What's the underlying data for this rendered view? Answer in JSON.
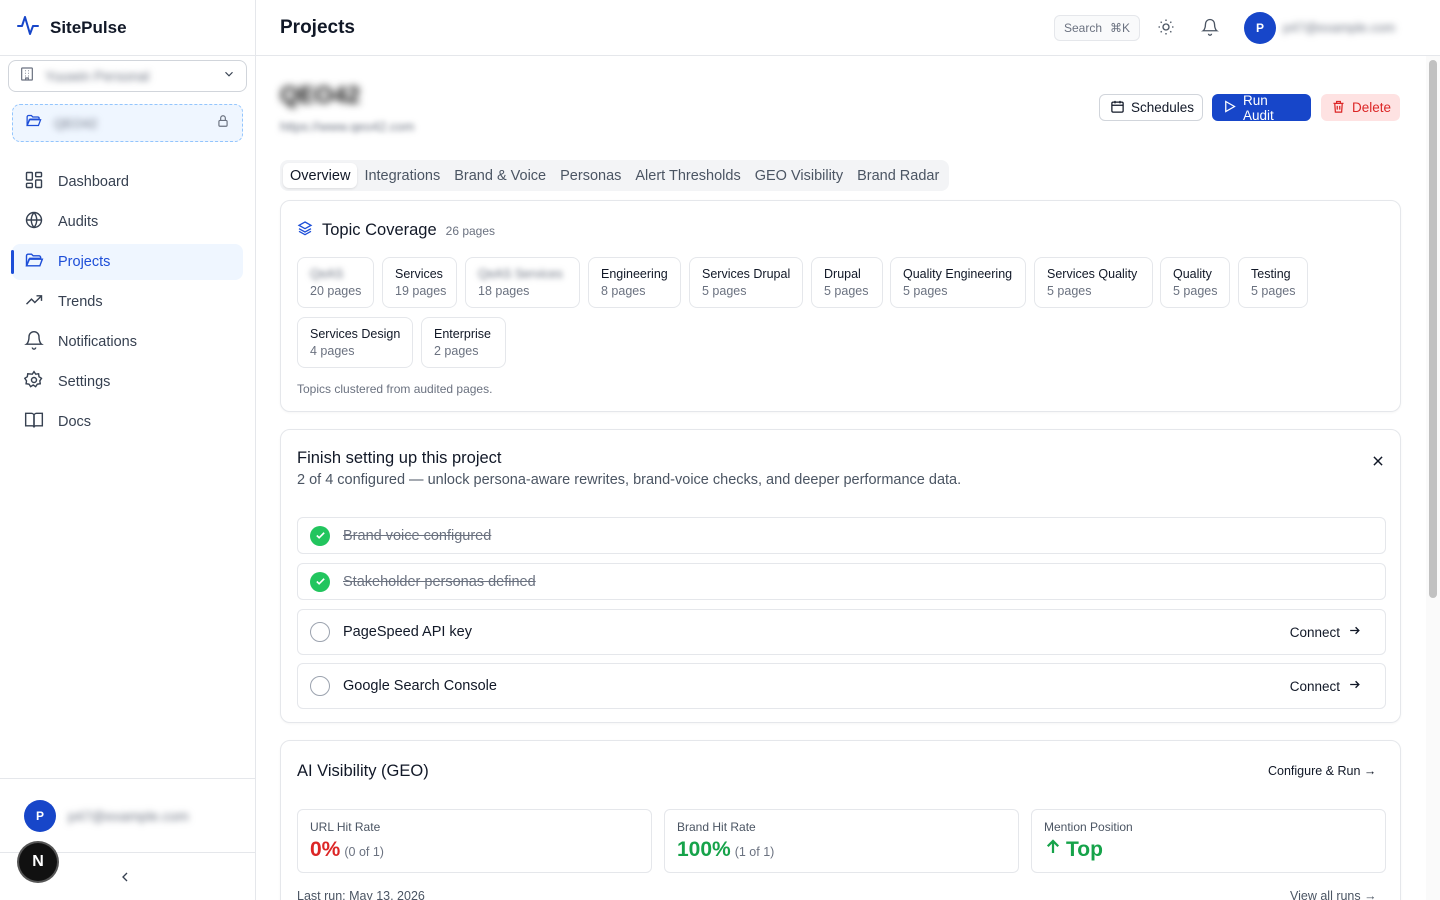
{
  "app": {
    "name": "SitePulse"
  },
  "sidebar": {
    "org_name": "Yuuwin Personal",
    "project_name": "QEO42",
    "items": [
      {
        "label": "Dashboard",
        "icon": "grid-icon"
      },
      {
        "label": "Audits",
        "icon": "globe-icon"
      },
      {
        "label": "Projects",
        "icon": "folder-icon",
        "active": true
      },
      {
        "label": "Trends",
        "icon": "trend-icon"
      },
      {
        "label": "Notifications",
        "icon": "bell-icon"
      },
      {
        "label": "Settings",
        "icon": "gear-icon"
      },
      {
        "label": "Docs",
        "icon": "book-icon"
      }
    ],
    "user_initial": "P",
    "user_email": "p47@example.com",
    "next_badge": "N"
  },
  "header": {
    "title": "Projects",
    "search_label": "Search",
    "search_shortcut": "⌘K",
    "user_initial": "P",
    "user_email": "p47@example.com"
  },
  "project": {
    "name": "QEO42",
    "url": "https://www.qeo42.com",
    "buttons": {
      "schedules": "Schedules",
      "run_audit": "Run Audit",
      "delete": "Delete"
    }
  },
  "tabs": [
    "Overview",
    "Integrations",
    "Brand & Voice",
    "Personas",
    "Alert Thresholds",
    "GEO Visibility",
    "Brand Radar"
  ],
  "topic_coverage": {
    "title": "Topic Coverage",
    "count": "26 pages",
    "chips": [
      {
        "name": "QeAS",
        "pages": "20 pages",
        "blurred": true
      },
      {
        "name": "Services",
        "pages": "19 pages"
      },
      {
        "name": "QeAS Services",
        "pages": "18 pages",
        "blurred": true
      },
      {
        "name": "Engineering",
        "pages": "8 pages"
      },
      {
        "name": "Services Drupal",
        "pages": "5 pages"
      },
      {
        "name": "Drupal",
        "pages": "5 pages"
      },
      {
        "name": "Quality Engineering",
        "pages": "5 pages"
      },
      {
        "name": "Services Quality",
        "pages": "5 pages"
      },
      {
        "name": "Quality",
        "pages": "5 pages"
      },
      {
        "name": "Testing",
        "pages": "5 pages"
      },
      {
        "name": "Services Design",
        "pages": "4 pages"
      },
      {
        "name": "Enterprise",
        "pages": "2 pages"
      }
    ],
    "footer": "Topics clustered from audited pages."
  },
  "setup": {
    "title": "Finish setting up this project",
    "subtitle": "2 of 4 configured — unlock persona-aware rewrites, brand-voice checks, and deeper performance data.",
    "items": [
      {
        "label": "Brand voice configured",
        "done": true
      },
      {
        "label": "Stakeholder personas defined",
        "done": true
      },
      {
        "label": "PageSpeed API key",
        "done": false,
        "action": "Connect"
      },
      {
        "label": "Google Search Console",
        "done": false,
        "action": "Connect"
      }
    ]
  },
  "geo": {
    "title": "AI Visibility (GEO)",
    "configure_link": "Configure & Run →",
    "metrics": [
      {
        "label": "URL Hit Rate",
        "value": "0%",
        "note": "(0 of 1)",
        "color": "#dc2626"
      },
      {
        "label": "Brand Hit Rate",
        "value": "100%",
        "note": "(1 of 1)",
        "color": "#16a34a"
      },
      {
        "label": "Mention Position",
        "value": "Top",
        "note": "",
        "color": "#16a34a"
      }
    ],
    "last_run": "Last run: May 13, 2026",
    "view_all": "View all runs →"
  }
}
